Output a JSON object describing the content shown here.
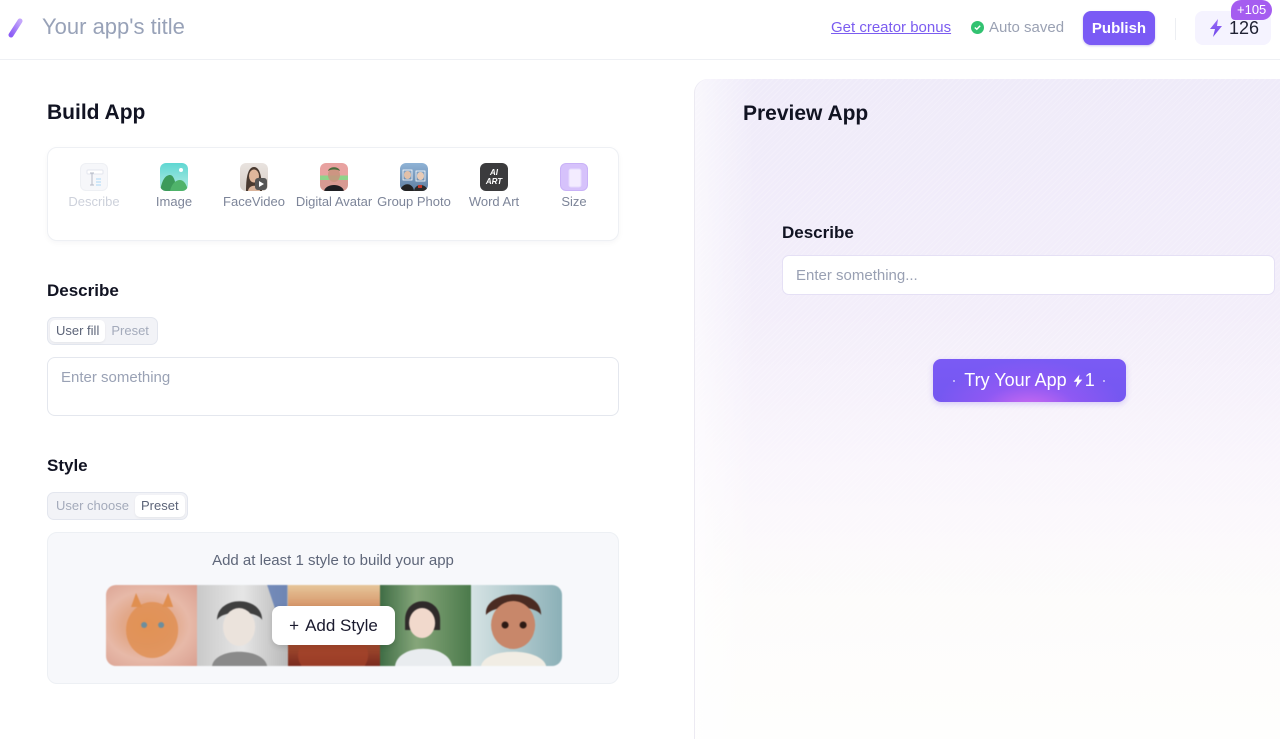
{
  "header": {
    "title_placeholder": "Your app's title",
    "bonus_link": "Get creator bonus",
    "autosave_status": "Auto saved",
    "publish_label": "Publish",
    "credits": "126",
    "credits_bonus_badge": "+105"
  },
  "build": {
    "title": "Build App",
    "widgets": [
      {
        "label": "Describe",
        "icon": "text-input-icon",
        "disabled": true
      },
      {
        "label": "Image",
        "icon": "image-icon",
        "disabled": false
      },
      {
        "label": "FaceVideo",
        "icon": "face-video-icon",
        "disabled": false
      },
      {
        "label": "Digital Avatar",
        "icon": "digital-avatar-icon",
        "disabled": false
      },
      {
        "label": "Group Photo",
        "icon": "group-photo-icon",
        "disabled": false
      },
      {
        "label": "Word Art",
        "icon": "word-art-icon",
        "disabled": false
      },
      {
        "label": "Size",
        "icon": "size-icon",
        "disabled": false
      }
    ],
    "word_art_icon_text": "AI ART",
    "describe": {
      "title": "Describe",
      "modes": [
        "User fill",
        "Preset"
      ],
      "active_mode": "User fill",
      "placeholder": "Enter something",
      "value": ""
    },
    "style": {
      "title": "Style",
      "modes": [
        "User choose",
        "Preset"
      ],
      "active_mode": "Preset",
      "hint": "Add at least 1 style to build your app",
      "add_button": "Add Style",
      "add_icon": "+"
    }
  },
  "preview": {
    "title": "Preview App",
    "field_label": "Describe",
    "field_placeholder": "Enter something...",
    "try_button": "Try Your App",
    "try_cost": "1"
  },
  "colors": {
    "accent": "#7a5af5",
    "badge": "#a55df0",
    "success": "#32c271",
    "link": "#7b5cf0"
  }
}
